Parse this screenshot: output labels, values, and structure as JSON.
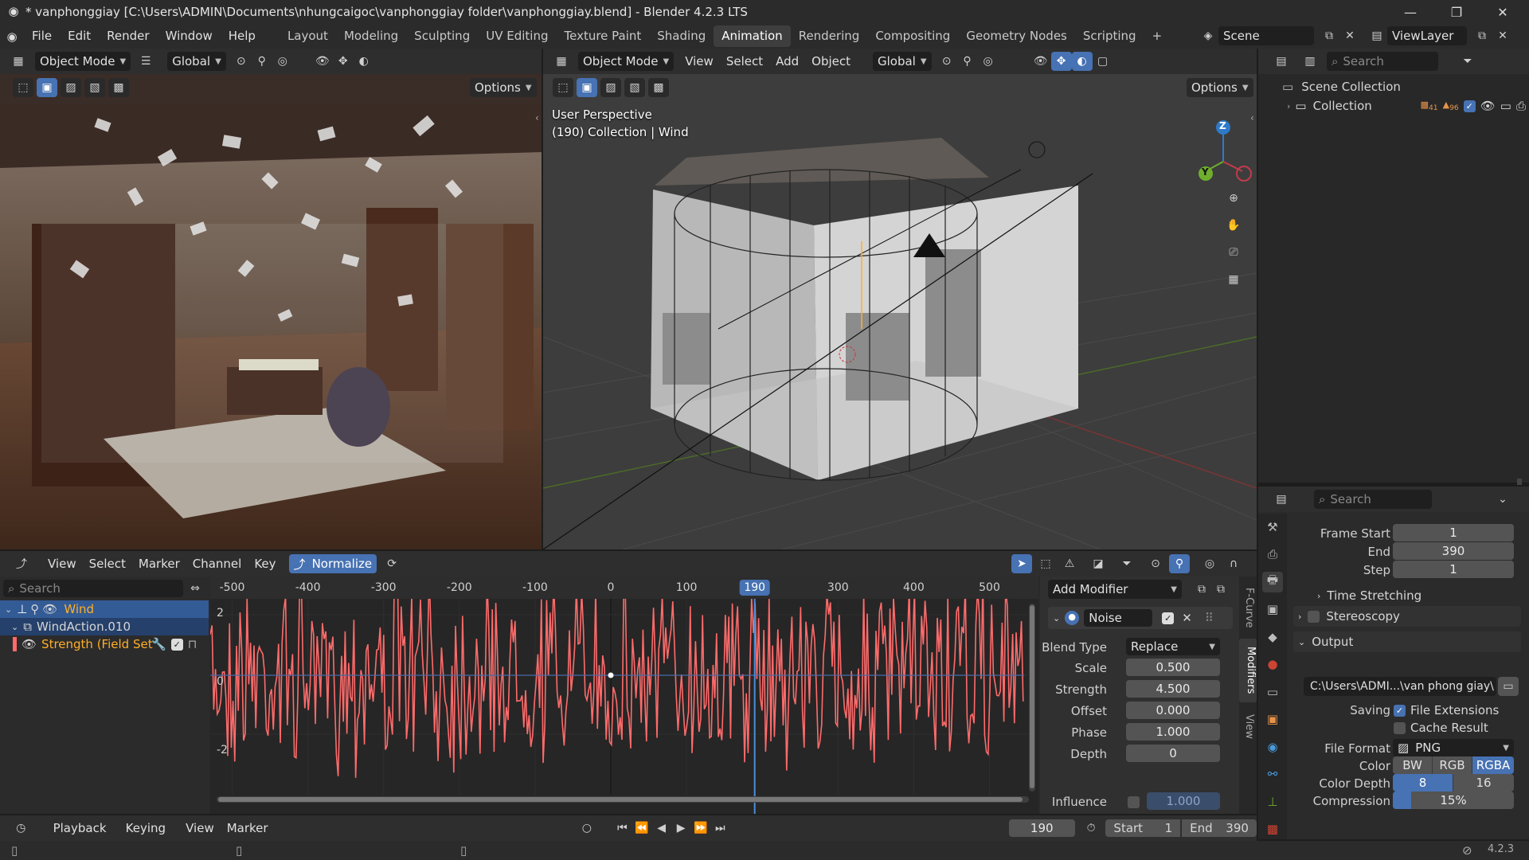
{
  "window": {
    "title": "* vanphonggiay [C:\\Users\\ADMIN\\Documents\\nhungcaigoc\\vanphonggiay folder\\vanphonggiay.blend] - Blender 4.2.3 LTS",
    "minimize": "—",
    "maximize": "❐",
    "close": "✕"
  },
  "menu": {
    "items": [
      "File",
      "Edit",
      "Render",
      "Window",
      "Help"
    ],
    "workspaces": [
      "Layout",
      "Modeling",
      "Sculpting",
      "UV Editing",
      "Texture Paint",
      "Shading",
      "Animation",
      "Rendering",
      "Compositing",
      "Geometry Nodes",
      "Scripting"
    ],
    "active_workspace": "Animation",
    "add_workspace": "+",
    "scene": "Scene",
    "view_layer": "ViewLayer"
  },
  "left_viewport": {
    "mode": "Object Mode",
    "orientation": "Global",
    "options": "Options"
  },
  "right_viewport": {
    "mode": "Object Mode",
    "menus": [
      "View",
      "Select",
      "Add",
      "Object"
    ],
    "orientation": "Global",
    "options": "Options",
    "overlay_line1": "User Perspective",
    "overlay_line2": "(190) Collection | Wind",
    "gizmo": {
      "z": "Z",
      "y": "Y"
    }
  },
  "outliner": {
    "search_placeholder": "Search",
    "scene_collection": "Scene Collection",
    "collection": "Collection",
    "badge1": "41",
    "badge2": "96"
  },
  "graph_editor": {
    "menus": [
      "View",
      "Select",
      "Marker",
      "Channel",
      "Key"
    ],
    "normalize": "Normalize",
    "search_placeholder": "Search",
    "channels": [
      {
        "name": "Wind",
        "color": "#ffaf29"
      },
      {
        "name": "WindAction.010",
        "color": "#d6d6d6"
      },
      {
        "name": "Strength (Field Setti",
        "color": "#ffaf29"
      }
    ],
    "ruler": [
      "-500",
      "-400",
      "-300",
      "-200",
      "-100",
      "0",
      "100",
      "190",
      "300",
      "400",
      "500"
    ],
    "current_frame": "190",
    "y_labels": [
      "2",
      "0",
      "-2"
    ],
    "curve_color": "#ff6b6b"
  },
  "modifiers_panel": {
    "add_modifier": "Add Modifier",
    "modifier_name": "Noise",
    "fields": [
      {
        "label": "Blend Type",
        "value": "Replace"
      },
      {
        "label": "Scale",
        "value": "0.500"
      },
      {
        "label": "Strength",
        "value": "4.500"
      },
      {
        "label": "Offset",
        "value": "0.000"
      },
      {
        "label": "Phase",
        "value": "1.000"
      },
      {
        "label": "Depth",
        "value": "0"
      }
    ],
    "influence_label": "Influence",
    "influence_value": "1.000",
    "tabs": [
      "F-Curve",
      "Modifiers",
      "View"
    ]
  },
  "properties": {
    "search_placeholder": "Search",
    "frame_start_label": "Frame Start",
    "frame_start": "1",
    "end_label": "End",
    "end": "390",
    "step_label": "Step",
    "step": "1",
    "time_stretching": "Time Stretching",
    "stereoscopy": "Stereoscopy",
    "output": "Output",
    "output_path": "C:\\Users\\ADMI...\\van phong giay\\",
    "saving_label": "Saving",
    "file_extensions": "File Extensions",
    "cache_result": "Cache Result",
    "file_format_label": "File Format",
    "file_format": "PNG",
    "color_label": "Color",
    "color_options": [
      "BW",
      "RGB",
      "RGBA"
    ],
    "color_selected": "RGBA",
    "color_depth_label": "Color Depth",
    "color_depth_options": [
      "8",
      "16"
    ],
    "compression_label": "Compression",
    "compression": "15%",
    "compression_fraction": 0.15
  },
  "timeline": {
    "menus": [
      "Playback",
      "Keying",
      "View",
      "Marker"
    ],
    "current_frame": "190",
    "start_label": "Start",
    "start": "1",
    "end_label": "End",
    "end": "390"
  },
  "statusbar": {
    "version": "4.2.3"
  }
}
